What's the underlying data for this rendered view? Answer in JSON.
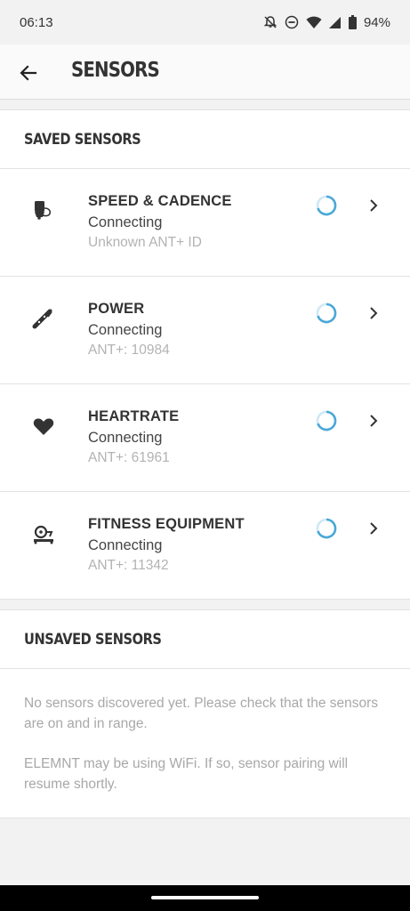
{
  "status_bar": {
    "time": "06:13",
    "battery": "94%",
    "icons": [
      "notifications-off-icon",
      "do-not-disturb-icon",
      "wifi-icon",
      "cell-signal-icon",
      "battery-icon"
    ]
  },
  "app_bar": {
    "title": "SENSORS",
    "back_icon": "arrow-left-icon"
  },
  "saved_sensors": {
    "header": "SAVED SENSORS",
    "items": [
      {
        "name": "SPEED & CADENCE",
        "status": "Connecting",
        "id": "Unknown ANT+ ID",
        "icon": "speed-cadence-sensor-icon"
      },
      {
        "name": "POWER",
        "status": "Connecting",
        "id": "ANT+: 10984",
        "icon": "power-meter-icon"
      },
      {
        "name": "HEARTRATE",
        "status": "Connecting",
        "id": "ANT+: 61961",
        "icon": "heart-icon"
      },
      {
        "name": "FITNESS EQUIPMENT",
        "status": "Connecting",
        "id": "ANT+: 11342",
        "icon": "trainer-icon"
      }
    ]
  },
  "unsaved_sensors": {
    "header": "UNSAVED SENSORS",
    "message_1": "No sensors discovered yet. Please check that the sensors are on and in range.",
    "message_2": "ELEMNT may be using WiFi. If so, sensor pairing will resume shortly."
  },
  "colors": {
    "spinner": "#4aa8d8",
    "background": "#f2f2f2",
    "card": "#ffffff"
  }
}
